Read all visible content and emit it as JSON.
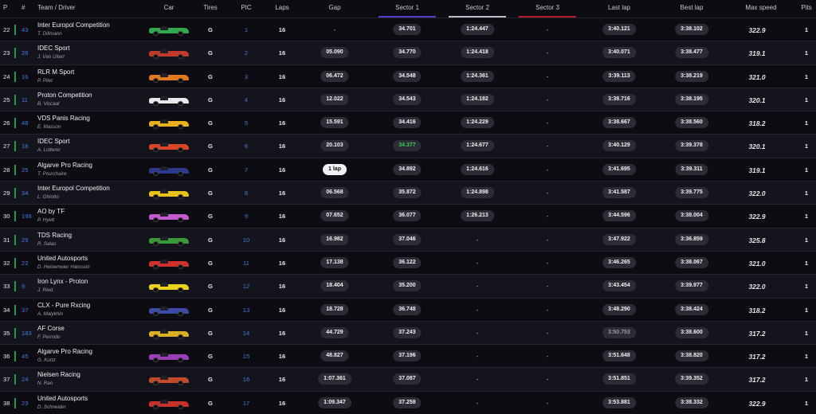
{
  "headers": {
    "p": "P",
    "num": "#",
    "team": "Team / Driver",
    "car": "Car",
    "tires": "Tires",
    "pic": "PIC",
    "laps": "Laps",
    "gap": "Gap",
    "s1": "Sector 1",
    "s2": "Sector 2",
    "s3": "Sector 3",
    "last": "Last lap",
    "best": "Best lap",
    "speed": "Max speed",
    "pits": "Pits"
  },
  "rows": [
    {
      "p": "22",
      "num": "43",
      "team": "Inter Europol Competition",
      "driver": "T. Dillmann",
      "car_color": "#2fa84f",
      "tires": "G",
      "pic": "1",
      "laps": "16",
      "gap": "-",
      "s1": "34.701",
      "s2": "1:24.447",
      "s3": "-",
      "last": "3:40.121",
      "best": "3:38.102",
      "speed": "322.9",
      "pits": "1"
    },
    {
      "p": "23",
      "num": "28",
      "team": "IDEC Sport",
      "driver": "J. Van Uitert",
      "car_color": "#c0392b",
      "tires": "G",
      "pic": "2",
      "laps": "16",
      "gap": "05.090",
      "s1": "34.770",
      "s2": "1:24.418",
      "s3": "-",
      "last": "3:40.071",
      "best": "3:38.477",
      "speed": "319.1",
      "pits": "1"
    },
    {
      "p": "24",
      "num": "16",
      "team": "RLR M Sport",
      "driver": "P. Pilet",
      "car_color": "#e07a1f",
      "tires": "G",
      "pic": "3",
      "laps": "16",
      "gap": "06.472",
      "s1": "34.548",
      "s2": "1:24.361",
      "s3": "-",
      "last": "3:39.113",
      "best": "3:38.219",
      "speed": "321.0",
      "pits": "1"
    },
    {
      "p": "25",
      "num": "11",
      "team": "Proton Competition",
      "driver": "B. Viscaal",
      "car_color": "#e8e8e8",
      "tires": "G",
      "pic": "4",
      "laps": "16",
      "gap": "12.022",
      "s1": "34.543",
      "s2": "1:24.182",
      "s3": "-",
      "last": "3:38.716",
      "best": "3:38.195",
      "speed": "320.1",
      "pits": "1"
    },
    {
      "p": "26",
      "num": "48",
      "team": "VDS Panis Racing",
      "driver": "E. Masson",
      "car_color": "#e9b21c",
      "tires": "G",
      "pic": "5",
      "laps": "16",
      "gap": "15.591",
      "s1": "34.416",
      "s2": "1:24.229",
      "s3": "-",
      "last": "3:38.667",
      "best": "3:38.560",
      "speed": "318.2",
      "pits": "1"
    },
    {
      "p": "27",
      "num": "18",
      "team": "IDEC Sport",
      "driver": "A. Lotterer",
      "car_color": "#d9462a",
      "tires": "G",
      "pic": "6",
      "laps": "16",
      "gap": "20.103",
      "s1": "34.377",
      "s1_style": "green",
      "s2": "1:24.677",
      "s3": "-",
      "last": "3:40.129",
      "best": "3:39.378",
      "speed": "320.1",
      "pits": "1"
    },
    {
      "p": "28",
      "num": "25",
      "team": "Algarve Pro Racing",
      "driver": "T. Pourchaire",
      "car_color": "#2b3a8f",
      "tires": "G",
      "pic": "7",
      "laps": "16",
      "gap": "1 lap",
      "gap_style": "light",
      "s1": "34.892",
      "s2": "1:24.616",
      "s3": "-",
      "last": "3:41.695",
      "best": "3:39.311",
      "speed": "319.1",
      "pits": "1"
    },
    {
      "p": "29",
      "num": "34",
      "team": "Inter Europol Competition",
      "driver": "L. Ghiotto",
      "car_color": "#e6c21a",
      "tires": "G",
      "pic": "8",
      "laps": "16",
      "gap": "06.568",
      "s1": "35.872",
      "s2": "1:24.898",
      "s3": "-",
      "last": "3:41.587",
      "best": "3:39.775",
      "speed": "322.0",
      "pits": "1"
    },
    {
      "p": "30",
      "num": "199",
      "team": "AO by TF",
      "driver": "P. Hyett",
      "car_color": "#c25bd0",
      "tires": "G",
      "pic": "9",
      "laps": "16",
      "gap": "07.652",
      "s1": "36.077",
      "s2": "1:26.213",
      "s3": "-",
      "last": "3:44.596",
      "best": "3:38.004",
      "speed": "322.9",
      "pits": "1"
    },
    {
      "p": "31",
      "num": "29",
      "team": "TDS Racing",
      "driver": "R. Salas",
      "car_color": "#3a9a3a",
      "tires": "G",
      "pic": "10",
      "laps": "16",
      "gap": "16.982",
      "s1": "37.046",
      "s2": "-",
      "s3": "-",
      "last": "3:47.922",
      "best": "3:36.859",
      "speed": "325.8",
      "pits": "1"
    },
    {
      "p": "32",
      "num": "22",
      "team": "United Autosports",
      "driver": "D. Heinemeier Hansson",
      "car_color": "#d0312d",
      "tires": "G",
      "pic": "11",
      "laps": "16",
      "gap": "17.138",
      "s1": "36.122",
      "s2": "-",
      "s3": "-",
      "last": "3:46.265",
      "best": "3:38.067",
      "speed": "321.0",
      "pits": "1"
    },
    {
      "p": "33",
      "num": "9",
      "team": "Iron Lynx - Proton",
      "driver": "J. Ried",
      "car_color": "#e8d21c",
      "tires": "G",
      "pic": "12",
      "laps": "16",
      "gap": "18.404",
      "s1": "35.200",
      "s2": "-",
      "s3": "-",
      "last": "3:43.454",
      "best": "3:39.977",
      "speed": "322.0",
      "pits": "1"
    },
    {
      "p": "34",
      "num": "37",
      "team": "CLX - Pure Rxcing",
      "driver": "A. Malykhin",
      "car_color": "#3c4aa8",
      "tires": "G",
      "pic": "13",
      "laps": "16",
      "gap": "18.728",
      "s1": "36.748",
      "s2": "-",
      "s3": "-",
      "last": "3:48.290",
      "best": "3:38.424",
      "speed": "318.2",
      "pits": "1"
    },
    {
      "p": "35",
      "num": "183",
      "team": "AF Corse",
      "driver": "F. Perrodo",
      "car_color": "#d9b021",
      "tires": "G",
      "pic": "14",
      "laps": "16",
      "gap": "44.729",
      "s1": "37.243",
      "s2": "-",
      "s3": "-",
      "last": "3:50.753",
      "last_style": "dim",
      "best": "3:38.600",
      "speed": "317.2",
      "pits": "1"
    },
    {
      "p": "36",
      "num": "45",
      "team": "Algarve Pro Racing",
      "driver": "G. Kurtz",
      "car_color": "#9a3fb8",
      "tires": "G",
      "pic": "15",
      "laps": "16",
      "gap": "48.827",
      "s1": "37.196",
      "s2": "-",
      "s3": "-",
      "last": "3:51.648",
      "best": "3:38.820",
      "speed": "317.2",
      "pits": "1"
    },
    {
      "p": "37",
      "num": "24",
      "team": "Nielsen Racing",
      "driver": "N. Rao",
      "car_color": "#c24a2a",
      "tires": "G",
      "pic": "16",
      "laps": "16",
      "gap": "1:07.361",
      "s1": "37.087",
      "s2": "-",
      "s3": "-",
      "last": "3:51.851",
      "best": "3:39.352",
      "speed": "317.2",
      "pits": "1"
    },
    {
      "p": "38",
      "num": "23",
      "team": "United Autosports",
      "driver": "D. Schneider",
      "car_color": "#c8302c",
      "tires": "G",
      "pic": "17",
      "laps": "16",
      "gap": "1:09.347",
      "s1": "37.258",
      "s2": "-",
      "s3": "-",
      "last": "3:53.881",
      "best": "3:38.332",
      "speed": "322.9",
      "pits": "1"
    }
  ]
}
